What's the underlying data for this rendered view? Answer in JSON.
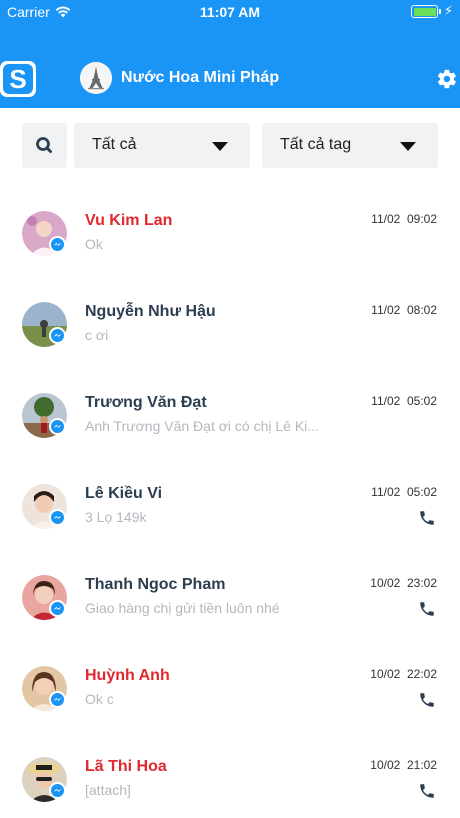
{
  "status_bar": {
    "carrier": "Carrier",
    "time": "11:07 AM",
    "battery_color": "#6ae05a"
  },
  "header": {
    "app_logo_letter": "S",
    "page_title": "Nước Hoa Mini Pháp",
    "bg_color": "#1a94f5"
  },
  "filters": {
    "search_icon": "search-icon",
    "status_filter": "Tất cả",
    "tag_filter": "Tất cả tag"
  },
  "conversations": [
    {
      "name": "Vu Kim Lan",
      "preview": "Ok",
      "date": "11/02",
      "time": "09:02",
      "unread": true,
      "phone": false
    },
    {
      "name": "Nguyễn Như Hậu",
      "preview": "c ơi",
      "date": "11/02",
      "time": "08:02",
      "unread": false,
      "phone": false
    },
    {
      "name": "Trương Văn Đạt",
      "preview": "Anh Trương Văn Đạt ơi có chị Lê Ki...",
      "date": "11/02",
      "time": "05:02",
      "unread": false,
      "phone": false
    },
    {
      "name": "Lê Kiều Vi",
      "preview": "3 Lọ 149k",
      "date": "11/02",
      "time": "05:02",
      "unread": false,
      "phone": true
    },
    {
      "name": "Thanh Ngoc Pham",
      "preview": "Giao hàng chị gửi tiền luôn nhé",
      "date": "10/02",
      "time": "23:02",
      "unread": false,
      "phone": true
    },
    {
      "name": "Huỳnh Anh",
      "preview": "Ok c",
      "date": "10/02",
      "time": "22:02",
      "unread": true,
      "phone": true
    },
    {
      "name": "Lã Thi Hoa",
      "preview": "[attach]",
      "date": "10/02",
      "time": "21:02",
      "unread": true,
      "phone": true
    }
  ]
}
